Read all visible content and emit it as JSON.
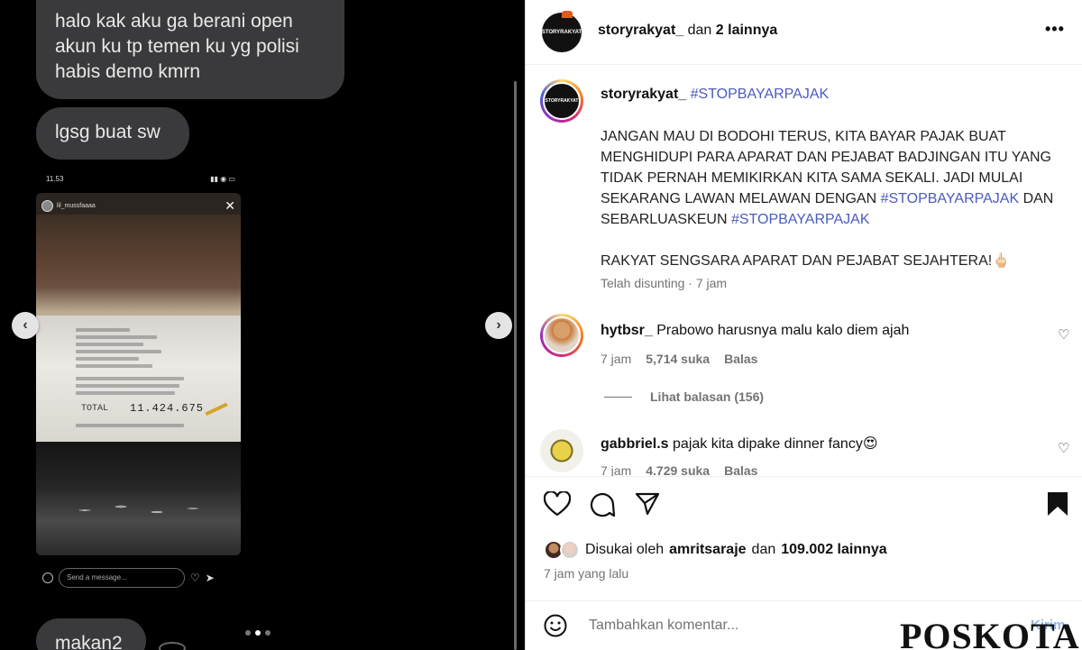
{
  "media": {
    "bubble1": "halo kak aku ga berani open akun ku tp temen ku yg polisi habis demo kmrn",
    "bubble2": "lgsg buat sw",
    "bubble3": "makan2",
    "phone_time": "11.53",
    "story_user": "lil_mussfaaaa",
    "receipt_total_label": "TOTAL",
    "receipt_total_value": "11.424.675",
    "message_placeholder": "Send a message...",
    "carousel": {
      "count": 3,
      "active_index": 1
    }
  },
  "post": {
    "header": {
      "username": "storyrakyat_",
      "joiner": "dan",
      "others": "2 lainnya",
      "avatar_text": "STORYRAKYAT"
    },
    "caption": {
      "username": "storyrakyat_",
      "hashtag_head": "#STOPBAYARPAJAK",
      "line1_a": "JANGAN MAU DI BODOHI TERUS, KITA BAYAR PAJAK BUAT MENGHIDUPI PARA APARAT DAN PEJABAT BADJINGAN ITU YANG TIDAK PERNAH MEMIKIRKAN KITA SAMA SEKALI. JADI MULAI SEKARANG LAWAN MELAWAN DENGAN",
      "hashtag_1": "#STOPBAYARPAJAK",
      "line1_b": "DAN SEBARLUASKEUN",
      "hashtag_2": "#STOPBAYARPAJAK",
      "line2": "RAKYAT SENGSARA APARAT DAN PEJABAT SEJAHTERA!🖕🏻",
      "meta": "Telah disunting · 7 jam"
    },
    "comments": [
      {
        "username": "hytbsr_",
        "text": "Prabowo harusnya malu kalo diem ajah",
        "time": "7 jam",
        "likes": "5,714 suka",
        "reply": "Balas"
      },
      {
        "username": "gabbriel.s",
        "text": "pajak kita dipake dinner fancy😍",
        "time": "7 jam",
        "likes": "4.729 suka",
        "reply": "Balas"
      }
    ],
    "view_replies": "Lihat balasan (156)",
    "likes": {
      "prefix": "Disukai oleh",
      "user": "amritsaraje",
      "joiner": "dan",
      "count": "109.002 lainnya"
    },
    "post_time": "7 jam yang lalu",
    "add_comment_placeholder": "Tambahkan komentar...",
    "add_comment_post": "Kirim"
  },
  "watermark": "POSKOTA",
  "colors": {
    "hashtag": "#4a5bbf",
    "bubble": "#3a3a3c",
    "watermark_accent": "#d32020"
  }
}
